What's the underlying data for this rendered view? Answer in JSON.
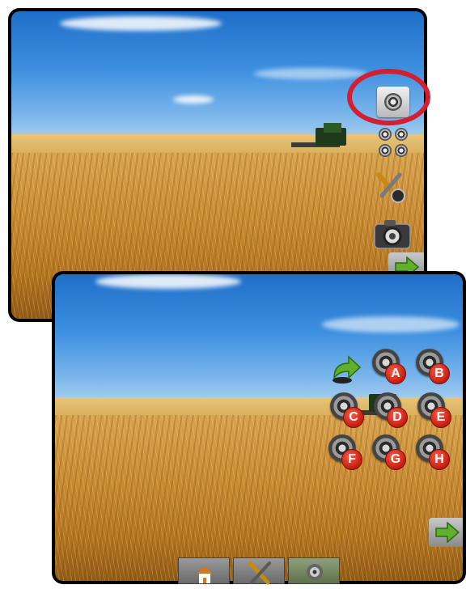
{
  "top_screen": {
    "side_menu": [
      {
        "icon": "single-camera-icon"
      },
      {
        "icon": "quad-camera-icon"
      },
      {
        "icon": "camera-settings-icon"
      },
      {
        "icon": "snapshot-camera-icon"
      }
    ],
    "next_icon": "green-arrow-icon",
    "highlight_color": "#d31f30"
  },
  "bottom_screen": {
    "back_icon": "green-return-arrow-icon",
    "cameras": [
      {
        "label": "A"
      },
      {
        "label": "B"
      },
      {
        "label": "C"
      },
      {
        "label": "D"
      },
      {
        "label": "E"
      },
      {
        "label": "F"
      },
      {
        "label": "G"
      },
      {
        "label": "H"
      }
    ],
    "next_icon": "green-arrow-icon",
    "toolbar": [
      {
        "icon": "home-icon"
      },
      {
        "icon": "tools-icon"
      },
      {
        "icon": "camera-icon",
        "active": true
      }
    ]
  },
  "colors": {
    "badge_red": "#c21d10",
    "arrow_green": "#5fb02d",
    "frame": "#000000"
  }
}
